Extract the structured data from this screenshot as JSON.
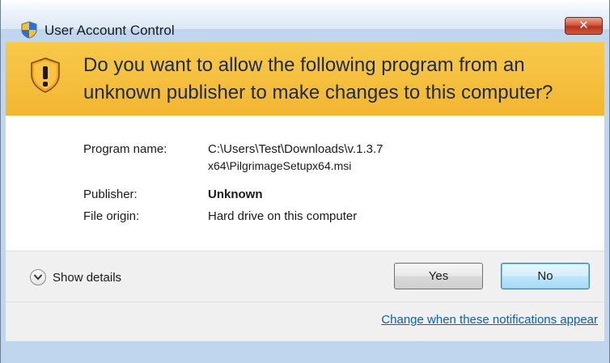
{
  "window": {
    "title": "User Account Control",
    "close_label": "✕",
    "close_color": "#c7412a"
  },
  "banner": {
    "question": "Do you want to allow the following program from an unknown publisher to make changes to this computer?",
    "icon": "uac-warning-shield-icon",
    "color": "#f2b632"
  },
  "details": {
    "program_name_label": "Program name:",
    "program_name_line1": "C:\\Users\\Test\\Downloads\\v.1.3.7",
    "program_name_line2": "x64\\PilgrimageSetupx64.msi",
    "publisher_label": "Publisher:",
    "publisher_value": "Unknown",
    "file_origin_label": "File origin:",
    "file_origin_value": "Hard drive on this computer"
  },
  "actions": {
    "show_details_label": "Show details",
    "yes_label": "Yes",
    "no_label": "No"
  },
  "footer": {
    "link_label": "Change when these notifications appear",
    "link_color": "#0b5fb5"
  }
}
